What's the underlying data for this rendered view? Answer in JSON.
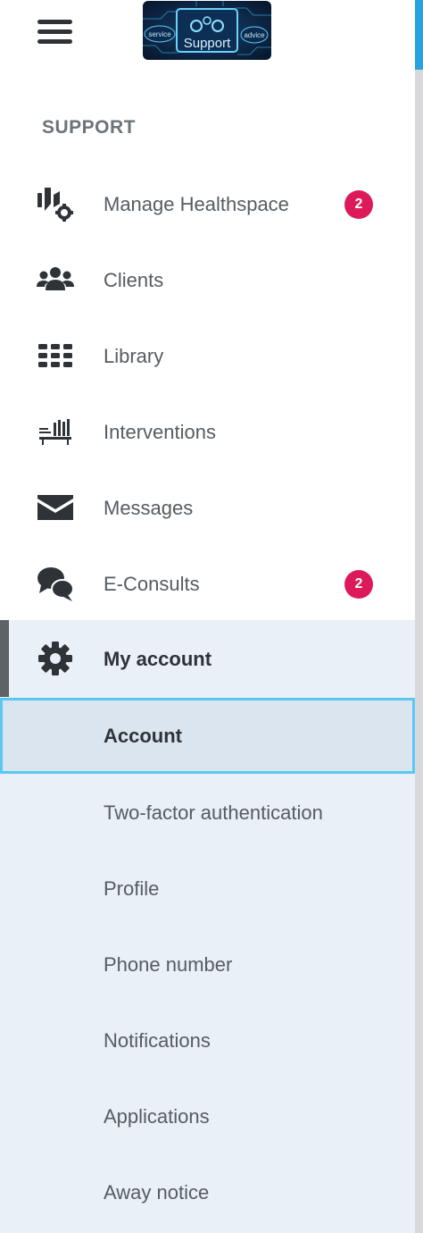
{
  "header": {
    "logo_text": "Support",
    "logo_tags": [
      "service",
      "advice"
    ]
  },
  "section": {
    "title": "SUPPORT"
  },
  "nav": {
    "items": [
      {
        "label": "Manage Healthspace",
        "icon": "manage-healthspace-icon",
        "badge": "2"
      },
      {
        "label": "Clients",
        "icon": "clients-icon"
      },
      {
        "label": "Library",
        "icon": "library-grid-icon"
      },
      {
        "label": "Interventions",
        "icon": "interventions-icon"
      },
      {
        "label": "Messages",
        "icon": "envelope-icon"
      },
      {
        "label": "E-Consults",
        "icon": "chat-bubbles-icon",
        "badge": "2"
      }
    ]
  },
  "account": {
    "label": "My account",
    "icon": "gear-icon",
    "subitems": [
      {
        "label": "Account",
        "active": true
      },
      {
        "label": "Two-factor authentication"
      },
      {
        "label": "Profile"
      },
      {
        "label": "Phone number"
      },
      {
        "label": "Notifications"
      },
      {
        "label": "Applications"
      },
      {
        "label": "Away notice"
      }
    ]
  },
  "colors": {
    "badge": "#dc1a5a",
    "active_border": "#5ac8f2",
    "group_background": "#eaf0f7",
    "accent": "#2aa2dc"
  }
}
